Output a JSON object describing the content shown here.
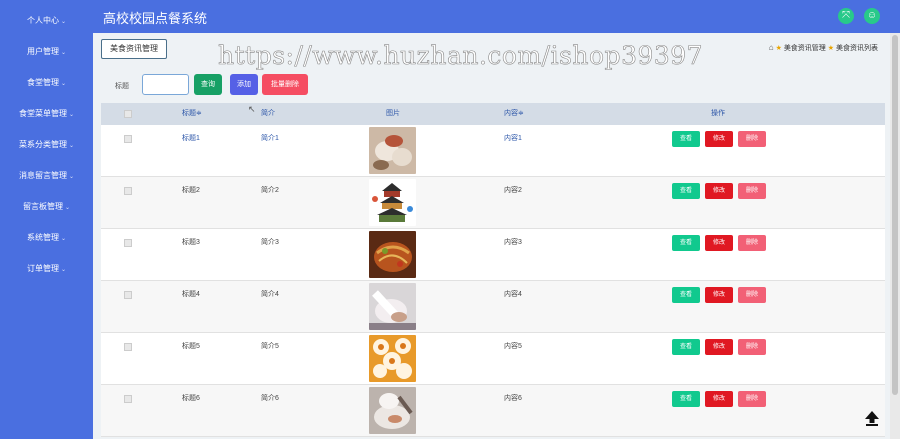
{
  "app": {
    "title": "高校校园点餐系统"
  },
  "header": {
    "icons": [
      {
        "name": "fullscreen-icon",
        "glyph": "⤧"
      },
      {
        "name": "user-icon",
        "glyph": "☺"
      }
    ]
  },
  "sidebar": {
    "items": [
      {
        "label": "个人中心"
      },
      {
        "label": "用户管理"
      },
      {
        "label": "食堂管理"
      },
      {
        "label": "食堂菜单管理"
      },
      {
        "label": "菜系分类管理"
      },
      {
        "label": "消息留言管理"
      },
      {
        "label": "留言板管理"
      },
      {
        "label": "系统管理"
      },
      {
        "label": "订单管理"
      }
    ]
  },
  "tab": {
    "label": "美食资讯管理"
  },
  "watermark": "https://www.huzhan.com/ishop39397",
  "breadcrumb": {
    "items": [
      "美食资讯管理",
      "美食资讯列表"
    ]
  },
  "search": {
    "label": "标题",
    "value": "",
    "search_btn": "查询",
    "add_btn": "添加",
    "batch_delete_btn": "批量删除"
  },
  "table": {
    "columns": [
      "标题",
      "简介",
      "图片",
      "内容",
      "操作"
    ],
    "sort_mark": "≑",
    "rows": [
      {
        "title": "标题1",
        "intro": "简介1",
        "content": "内容1"
      },
      {
        "title": "标题2",
        "intro": "简介2",
        "content": "内容2"
      },
      {
        "title": "标题3",
        "intro": "简介3",
        "content": "内容3"
      },
      {
        "title": "标题4",
        "intro": "简介4",
        "content": "内容4"
      },
      {
        "title": "标题5",
        "intro": "简介5",
        "content": "内容5"
      },
      {
        "title": "标题6",
        "intro": "简介6",
        "content": "内容6"
      }
    ],
    "row_actions": {
      "view": "查看",
      "edit": "修改",
      "delete": "删除"
    }
  },
  "colors": {
    "primary": "#4a6fe0",
    "search": "#17a065",
    "add": "#5560e6",
    "batch_delete": "#f54d62",
    "view": "#11c98e",
    "edit": "#e01822",
    "delete": "#f26076"
  }
}
